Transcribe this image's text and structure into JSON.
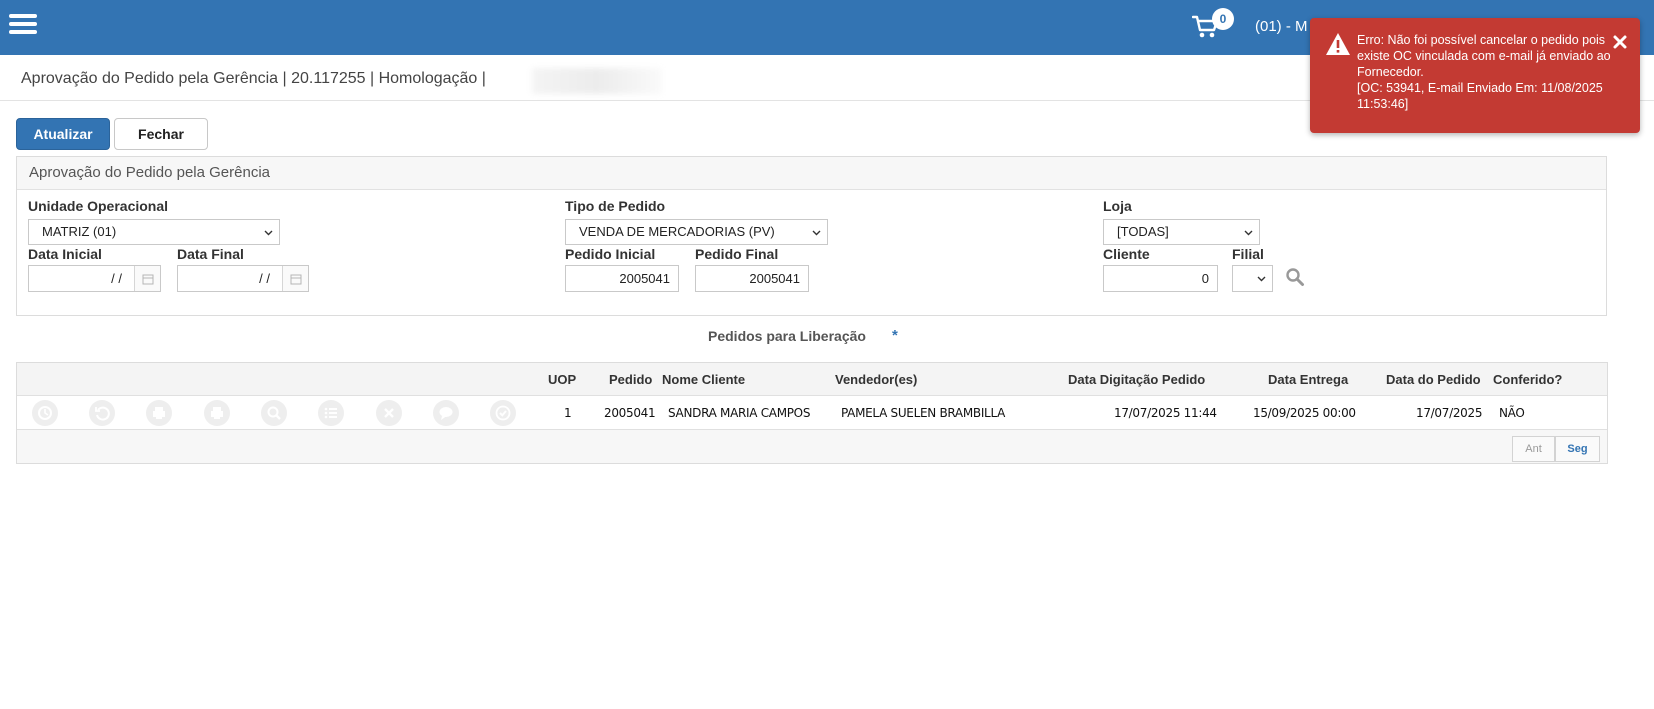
{
  "header": {
    "cart_count": "0",
    "user_text": "(01) - M"
  },
  "page": {
    "title": "Aprovação do Pedido pela Gerência | 20.117255 | Homologação |"
  },
  "toolbar": {
    "update_label": "Atualizar",
    "close_label": "Fechar"
  },
  "filters": {
    "panel_title": "Aprovação do Pedido pela Gerência",
    "unidade_label": "Unidade Operacional",
    "unidade_value": "MATRIZ (01)",
    "tipo_label": "Tipo de Pedido",
    "tipo_value": "VENDA DE MERCADORIAS (PV)",
    "loja_label": "Loja",
    "loja_value": "[TODAS]",
    "data_inicial_label": "Data Inicial",
    "data_inicial_value": "/ /",
    "data_final_label": "Data Final",
    "data_final_value": "/ /",
    "pedido_inicial_label": "Pedido Inicial",
    "pedido_inicial_value": "2005041",
    "pedido_final_label": "Pedido Final",
    "pedido_final_value": "2005041",
    "cliente_label": "Cliente",
    "cliente_value": "0",
    "filial_label": "Filial",
    "filial_value": ""
  },
  "orders": {
    "section_title": "Pedidos para Liberação",
    "required_mark": "*",
    "columns": {
      "uop": "UOP",
      "pedido": "Pedido",
      "nome_cliente": "Nome Cliente",
      "vendedor": "Vendedor(es)",
      "data_digitacao": "Data Digitação Pedido",
      "data_entrega": "Data Entrega",
      "data_pedido": "Data do Pedido",
      "conferido": "Conferido?"
    },
    "rows": [
      {
        "uop": "1",
        "pedido": "2005041",
        "nome_cliente": "SANDRA MARIA CAMPOS",
        "vendedor": "PAMELA SUELEN BRAMBILLA",
        "data_digitacao": "17/07/2025 11:44",
        "data_entrega": "15/09/2025 00:00",
        "data_pedido": "17/07/2025",
        "conferido": "NÃO"
      }
    ],
    "row_icons": [
      "history-icon",
      "undo-icon",
      "print-icon",
      "print-alt-icon",
      "search-icon",
      "list-icon",
      "cancel-icon",
      "comment-icon",
      "approve-icon"
    ],
    "pager": {
      "prev_label": "Ant",
      "next_label": "Seg"
    }
  },
  "toast": {
    "type": "error",
    "message_line1": "Erro: Não foi possível cancelar o pedido pois existe OC vinculada com e-mail já enviado ao Fornecedor.",
    "message_line2": "[OC: 53941, E-mail Enviado Em: 11/08/2025 11:53:46]"
  },
  "colors": {
    "brand": "#3374b3",
    "error": "#c33a33"
  }
}
